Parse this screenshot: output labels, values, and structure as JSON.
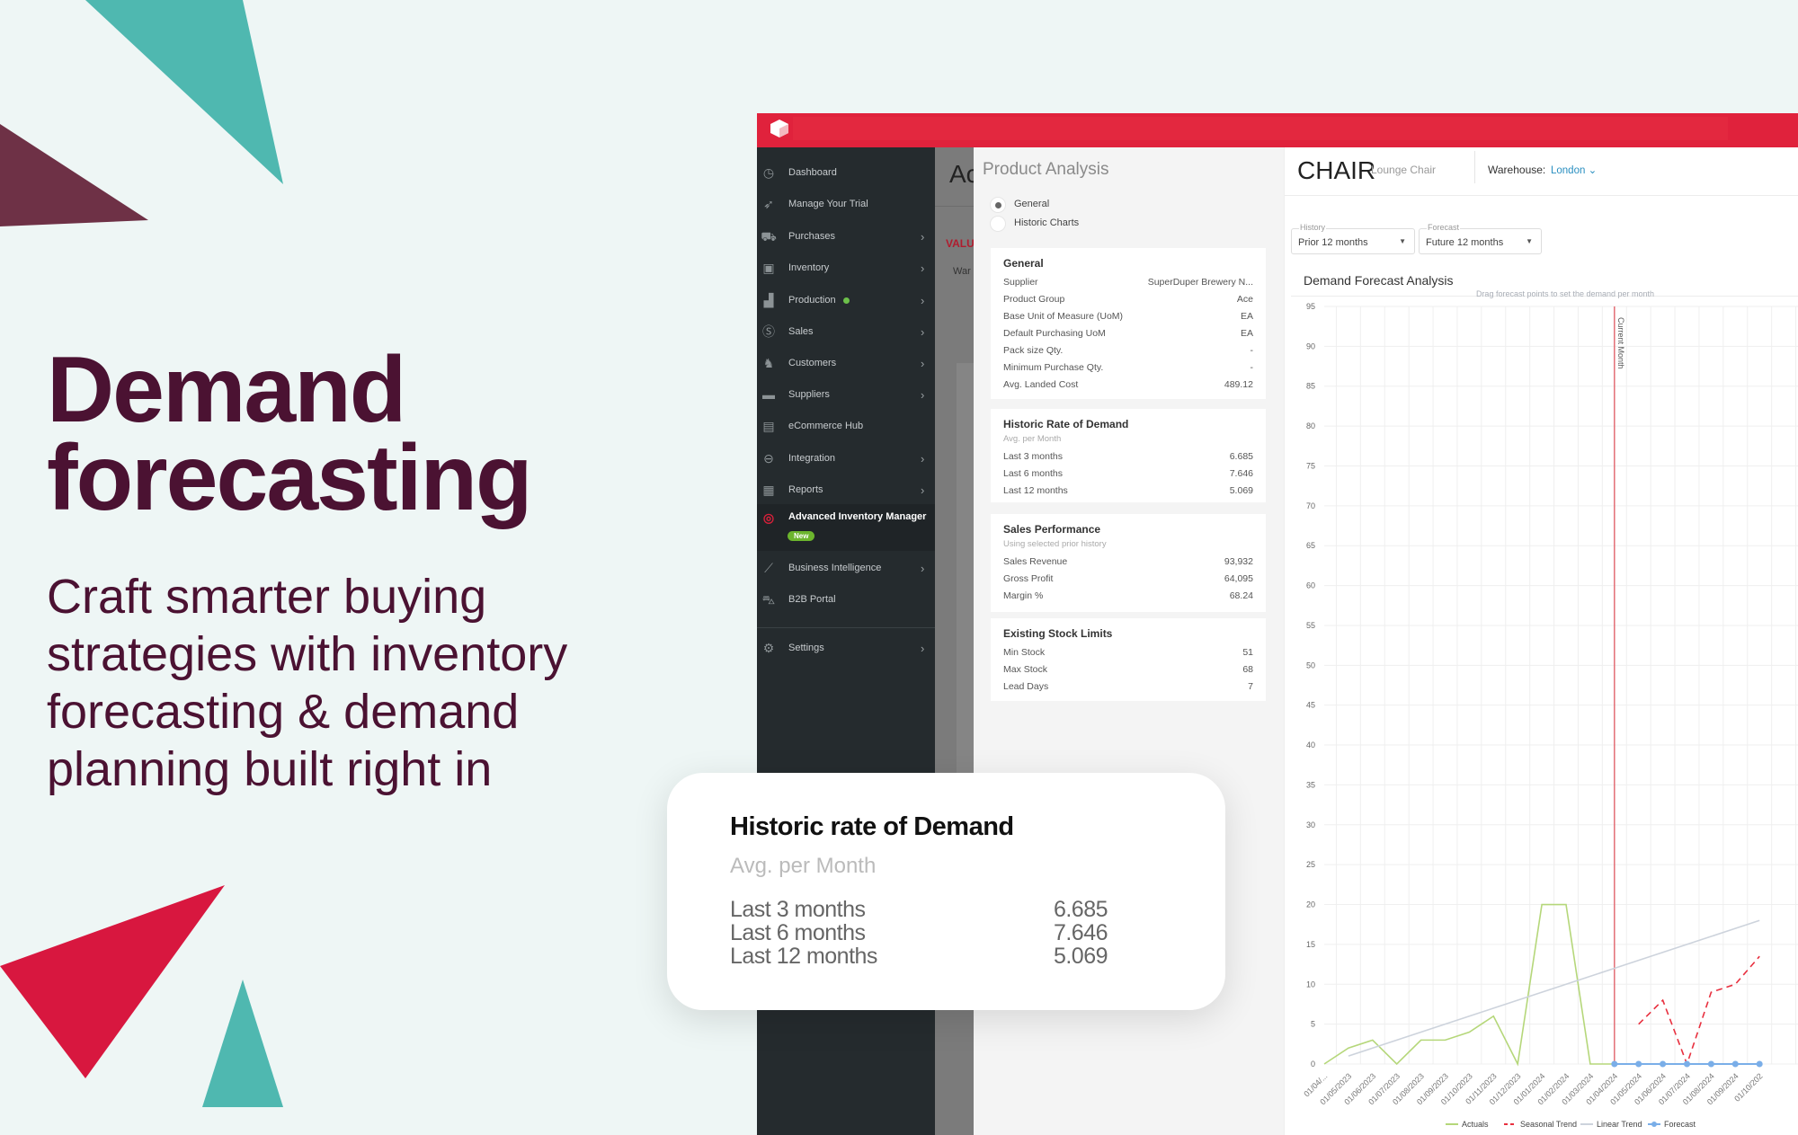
{
  "hero": {
    "title_line1": "Demand",
    "title_line2": "forecasting",
    "subtitle": "Craft smarter buying strategies with inventory forecasting & demand planning built right in"
  },
  "colors": {
    "brand_red": "#e0223c",
    "sidebar_bg": "#252b2e",
    "hero_text": "#4b1232",
    "teal": "#4fb8b0",
    "accent_blue": "#2a8fc0"
  },
  "sidebar": {
    "items": [
      {
        "label": "Dashboard",
        "icon": "dashboard-gauge-icon",
        "chevron": false
      },
      {
        "label": "Manage Your Trial",
        "icon": "rocket-icon",
        "chevron": false
      },
      {
        "label": "Purchases",
        "icon": "hand-truck-icon",
        "chevron": true
      },
      {
        "label": "Inventory",
        "icon": "box-icon",
        "chevron": true
      },
      {
        "label": "Production",
        "icon": "factory-icon",
        "chevron": true,
        "status_dot": true
      },
      {
        "label": "Sales",
        "icon": "dollar-icon",
        "chevron": true
      },
      {
        "label": "Customers",
        "icon": "customers-icon",
        "chevron": true
      },
      {
        "label": "Suppliers",
        "icon": "truck-icon",
        "chevron": true
      },
      {
        "label": "eCommerce Hub",
        "icon": "store-icon",
        "chevron": false
      },
      {
        "label": "Integration",
        "icon": "link-icon",
        "chevron": true
      },
      {
        "label": "Reports",
        "icon": "table-icon",
        "chevron": true
      },
      {
        "label": "Advanced Inventory Manager",
        "icon": "target-icon",
        "chevron": false,
        "badge": "New",
        "active": true
      },
      {
        "label": "Business Intelligence",
        "icon": "chart-line-icon",
        "chevron": true
      },
      {
        "label": "B2B Portal",
        "icon": "cart-icon",
        "chevron": false
      },
      {
        "label": "Settings",
        "icon": "gear-icon",
        "chevron": true
      }
    ]
  },
  "background_page": {
    "title_fragment": "Ac",
    "value_fragment": "VALU",
    "warehouse_fragment": "War"
  },
  "product_analysis": {
    "title": "Product Analysis",
    "view_options": [
      {
        "label": "General",
        "selected": true
      },
      {
        "label": "Historic Charts",
        "selected": false
      }
    ],
    "general": {
      "title": "General",
      "rows": [
        {
          "label": "Supplier",
          "value": "SuperDuper Brewery N..."
        },
        {
          "label": "Product Group",
          "value": "Ace"
        },
        {
          "label": "Base Unit of Measure (UoM)",
          "value": "EA"
        },
        {
          "label": "Default Purchasing UoM",
          "value": "EA"
        },
        {
          "label": "Pack size Qty.",
          "value": "-"
        },
        {
          "label": "Minimum Purchase Qty.",
          "value": "-"
        },
        {
          "label": "Avg. Landed Cost",
          "value": "489.12"
        }
      ]
    },
    "historic": {
      "title": "Historic Rate of Demand",
      "subtitle": "Avg. per Month",
      "rows": [
        {
          "label": "Last 3 months",
          "value": "6.685"
        },
        {
          "label": "Last 6 months",
          "value": "7.646"
        },
        {
          "label": "Last 12 months",
          "value": "5.069"
        }
      ]
    },
    "sales": {
      "title": "Sales Performance",
      "subtitle": "Using selected prior history",
      "rows": [
        {
          "label": "Sales Revenue",
          "value": "93,932"
        },
        {
          "label": "Gross Profit",
          "value": "64,095"
        },
        {
          "label": "Margin %",
          "value": "68.24"
        }
      ]
    },
    "stock": {
      "title": "Existing Stock Limits",
      "rows": [
        {
          "label": "Min Stock",
          "value": "51"
        },
        {
          "label": "Max Stock",
          "value": "68"
        },
        {
          "label": "Lead Days",
          "value": "7"
        }
      ]
    }
  },
  "product": {
    "code": "CHAIR",
    "name": "Lounge Chair",
    "warehouse_label": "Warehouse:",
    "warehouse_value": "London"
  },
  "filters": {
    "history_caption": "History",
    "history_value": "Prior 12 months",
    "forecast_caption": "Forecast",
    "forecast_value": "Future 12 months"
  },
  "chart_section_title": "Demand Forecast Analysis",
  "floating_card": {
    "title": "Historic rate of Demand",
    "subtitle": "Avg. per Month",
    "rows": [
      {
        "label": "Last 3 months",
        "value": "6.685"
      },
      {
        "label": "Last 6 months",
        "value": "7.646"
      },
      {
        "label": "Last 12 months",
        "value": "5.069"
      }
    ]
  },
  "chart_data": {
    "type": "line",
    "title": "",
    "annotation": "Drag forecast points to set the demand per month",
    "marker_label": "Current Month",
    "marker_x": "01/04/2024",
    "categories": [
      "01/04/...",
      "01/05/2023",
      "01/06/2023",
      "01/07/2023",
      "01/08/2023",
      "01/09/2023",
      "01/10/2023",
      "01/11/2023",
      "01/12/2023",
      "01/01/2024",
      "01/02/2024",
      "01/03/2024",
      "01/04/2024",
      "01/05/2024",
      "01/06/2024",
      "01/07/2024",
      "01/08/2024",
      "01/09/2024",
      "01/10/202"
    ],
    "ylim": [
      0,
      95
    ],
    "yticks": [
      0,
      5,
      10,
      15,
      20,
      25,
      30,
      35,
      40,
      45,
      50,
      55,
      60,
      65,
      70,
      75,
      80,
      85,
      90,
      95
    ],
    "grid": true,
    "legend": "bottom",
    "series": [
      {
        "name": "Actuals",
        "color": "#b5d77a",
        "dash": false,
        "values": [
          0,
          2,
          3,
          0,
          3,
          3,
          4,
          6,
          0,
          20,
          20,
          0,
          0,
          null,
          null,
          null,
          null,
          null,
          null
        ]
      },
      {
        "name": "Seasonal Trend",
        "color": "#e8303f",
        "dash": true,
        "values": [
          null,
          null,
          null,
          null,
          null,
          null,
          null,
          null,
          null,
          null,
          null,
          null,
          null,
          5,
          8,
          0,
          9,
          10,
          13.5
        ]
      },
      {
        "name": "Linear Trend",
        "color": "#cdd3dc",
        "dash": false,
        "values": [
          null,
          1,
          2,
          3,
          4,
          5,
          6,
          7,
          8,
          9,
          10,
          11,
          12,
          13,
          14,
          15,
          16,
          17,
          18
        ]
      },
      {
        "name": "Forecast",
        "color": "#7aaee8",
        "dash": false,
        "markers": true,
        "values": [
          null,
          null,
          null,
          null,
          null,
          null,
          null,
          null,
          null,
          null,
          null,
          null,
          0,
          0,
          0,
          0,
          0,
          0,
          0
        ]
      }
    ]
  }
}
